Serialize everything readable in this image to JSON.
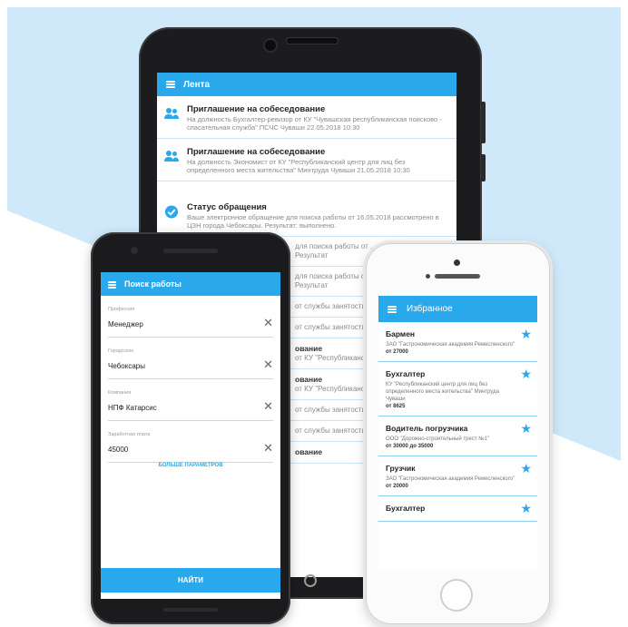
{
  "colors": {
    "accent": "#29a9ec",
    "background_blue": "#cfe9fa",
    "device_dark": "#1c1c1e"
  },
  "tablet": {
    "header_title": "Лента",
    "items": [
      {
        "icon": "people-icon",
        "title": "Приглашение на собеседование",
        "body": "На должность Бухгалтер-ревизор от КУ \"Чувашская республиканская поисково - спасательная служба\" ПСЧС Чуваши 22.05.2018 10:30"
      },
      {
        "icon": "people-icon",
        "title": "Приглашение на собеседование",
        "body": "На должность Экономист от КУ \"Республиканский центр для лиц без определенного места жительства\" Минтруда Чуваши 21.05.2018 10:30"
      },
      {
        "icon": "check-circle-icon",
        "title": "Статус обращения",
        "body": "Ваше электронное обращение для поиска работы от 16.05.2018 рассмотрено в ЦЗН города Чебоксары. Результат: выполнено."
      }
    ],
    "fragments": [
      {
        "title": "",
        "body": "для поиска работы от ... Чебоксары. Результат"
      },
      {
        "title": "",
        "body": "для поиска работы от ... Чебоксары. Результат"
      },
      {
        "title": "",
        "body": "от службы занятости"
      },
      {
        "title": "",
        "body": "от службы занятости"
      },
      {
        "title": "ование",
        "body": "от КУ \"Республиканско... Минтруда Чува"
      },
      {
        "title": "ование",
        "body": "от КУ \"Республиканско... Минтруда Чува"
      },
      {
        "title": "",
        "body": "от службы занятости"
      },
      {
        "title": "",
        "body": "от службы занятости"
      },
      {
        "title": "ование",
        "body": ""
      }
    ]
  },
  "android": {
    "header_title": "Поиск работы",
    "fields": [
      {
        "label": "Профессия",
        "value": "Менеджер"
      },
      {
        "label": "Город/село",
        "value": "Чебоксары"
      },
      {
        "label": "Компания",
        "value": "НПФ Катарсис"
      },
      {
        "label": "Заработная плата",
        "value": "45000"
      }
    ],
    "more_label": "БОЛЬШЕ ПАРАМЕТРОВ",
    "find_label": "НАЙТИ"
  },
  "iphone": {
    "header_title": "Избранное",
    "items": [
      {
        "title": "Бармен",
        "body": "ЗАО \"Гастрономическая академия Ремесленского\"",
        "salary": "от 27000"
      },
      {
        "title": "Бухгалтер",
        "body": "КУ \"Республиканский центр для лиц без определенного места жительства\" Минтруда Чуваши",
        "salary": "от 8625"
      },
      {
        "title": "Водитель погрузчика",
        "body": "ООО \"Дорожно-строительный трест №1\"",
        "salary": "от 30000 до 35000"
      },
      {
        "title": "Грузчик",
        "body": "ЗАО \"Гастрономическая академия Ремесленского\"",
        "salary": "от 20000"
      },
      {
        "title": "Бухгалтер",
        "body": "",
        "salary": ""
      }
    ]
  }
}
